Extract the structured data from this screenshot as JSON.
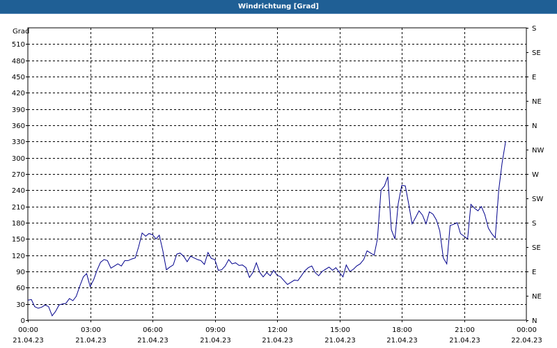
{
  "window": {
    "title": "Windrichtung [Grad]"
  },
  "chart_data": {
    "type": "line",
    "title": "Windrichtung [Grad]",
    "ylabel": "Grad",
    "ylim": [
      0,
      540
    ],
    "xlim": [
      "2023-04-21 00:00",
      "2023-04-22 00:00"
    ],
    "grid": true,
    "y_ticks": [
      0,
      30,
      60,
      90,
      120,
      150,
      180,
      210,
      240,
      270,
      300,
      330,
      360,
      390,
      420,
      450,
      480,
      510
    ],
    "x_ticks": [
      {
        "time": "00:00",
        "date": "21.04.23"
      },
      {
        "time": "03:00",
        "date": "21.04.23"
      },
      {
        "time": "06:00",
        "date": "21.04.23"
      },
      {
        "time": "09:00",
        "date": "21.04.23"
      },
      {
        "time": "12:00",
        "date": "21.04.23"
      },
      {
        "time": "15:00",
        "date": "21.04.23"
      },
      {
        "time": "18:00",
        "date": "21.04.23"
      },
      {
        "time": "21:00",
        "date": "21.04.23"
      },
      {
        "time": "00:00",
        "date": "22.04.23"
      }
    ],
    "y2_ticks": [
      {
        "value": 0,
        "label": "N"
      },
      {
        "value": 45,
        "label": "NE"
      },
      {
        "value": 90,
        "label": "E"
      },
      {
        "value": 135,
        "label": "SE"
      },
      {
        "value": 180,
        "label": "S"
      },
      {
        "value": 225,
        "label": "SW"
      },
      {
        "value": 270,
        "label": "W"
      },
      {
        "value": 315,
        "label": "NW"
      },
      {
        "value": 360,
        "label": "N"
      },
      {
        "value": 405,
        "label": "NE"
      },
      {
        "value": 450,
        "label": "E"
      },
      {
        "value": 495,
        "label": "SE"
      },
      {
        "value": 540,
        "label": "S"
      }
    ],
    "series": [
      {
        "color": "#00008b",
        "x_hours": [
          0,
          0.17,
          0.33,
          0.5,
          0.67,
          0.83,
          1,
          1.17,
          1.33,
          1.5,
          1.67,
          1.83,
          2,
          2.17,
          2.33,
          2.5,
          2.67,
          2.83,
          3,
          3.17,
          3.33,
          3.5,
          3.67,
          3.83,
          4,
          4.17,
          4.33,
          4.5,
          4.67,
          4.83,
          5,
          5.17,
          5.33,
          5.5,
          5.67,
          5.83,
          6,
          6.17,
          6.33,
          6.5,
          6.67,
          6.83,
          7,
          7.17,
          7.33,
          7.5,
          7.67,
          7.83,
          8,
          8.17,
          8.33,
          8.5,
          8.67,
          8.83,
          9,
          9.17,
          9.33,
          9.5,
          9.67,
          9.83,
          10,
          10.17,
          10.33,
          10.5,
          10.67,
          10.83,
          11,
          11.17,
          11.33,
          11.5,
          11.67,
          11.83,
          12,
          12.17,
          12.33,
          12.5,
          12.67,
          12.83,
          13,
          13.17,
          13.33,
          13.5,
          13.67,
          13.83,
          14,
          14.17,
          14.33,
          14.5,
          14.67,
          14.83,
          15,
          15.17,
          15.33,
          15.5,
          15.67,
          15.83,
          16,
          16.17,
          16.33,
          16.5,
          16.67,
          16.83,
          17,
          17.17,
          17.33,
          17.5,
          17.67,
          17.83,
          18,
          18.17,
          18.33,
          18.5,
          18.67,
          18.83,
          19,
          19.17,
          19.33,
          19.5,
          19.67,
          19.83,
          20,
          20.17,
          20.33,
          20.5,
          20.67,
          20.83,
          21,
          21.17,
          21.33,
          21.5,
          21.67,
          21.83,
          22,
          22.17,
          22.33,
          22.5,
          22.67,
          22.83,
          23,
          23.17,
          23.33,
          23.5,
          23.67,
          23.83,
          24
        ],
        "values": [
          37,
          38,
          25,
          22,
          24,
          28,
          25,
          8,
          16,
          28,
          30,
          31,
          40,
          36,
          44,
          63,
          80,
          86,
          62,
          75,
          92,
          107,
          112,
          110,
          96,
          100,
          104,
          100,
          110,
          110,
          113,
          115,
          135,
          161,
          155,
          160,
          158,
          150,
          157,
          128,
          93,
          98,
          102,
          122,
          124,
          118,
          108,
          118,
          115,
          112,
          110,
          103,
          125,
          114,
          112,
          92,
          93,
          100,
          112,
          104,
          106,
          101,
          102,
          97,
          79,
          88,
          106,
          88,
          80,
          88,
          82,
          92,
          83,
          80,
          73,
          66,
          70,
          74,
          73,
          82,
          91,
          97,
          100,
          88,
          82,
          90,
          94,
          98,
          92,
          97,
          88,
          80,
          102,
          90,
          94,
          100,
          104,
          112,
          128,
          124,
          120,
          150,
          240,
          248,
          265,
          167,
          150,
          215,
          249,
          248,
          216,
          178,
          190,
          202,
          194,
          178,
          200,
          196,
          185,
          165,
          115,
          104,
          175,
          177,
          180,
          160,
          155,
          150,
          214,
          207,
          202,
          210,
          195,
          170,
          160,
          152,
          240,
          290,
          330
        ]
      }
    ]
  }
}
